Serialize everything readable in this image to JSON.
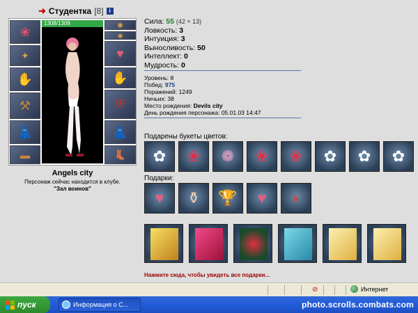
{
  "character": {
    "name": "Студентка",
    "level": "[8]",
    "hp": "1308/1308",
    "hp_fraction": 1.0,
    "city": "Angels city",
    "location_line1": "Персонаж сейчас находится в клубе.",
    "location_line2": "\"Зал воинов\""
  },
  "stats": {
    "strength_label": "Сила:",
    "strength_value": "55",
    "strength_bonus": "(42 + 13)",
    "agility_label": "Ловкость:",
    "agility_value": "3",
    "intuition_label": "Интуиция:",
    "intuition_value": "3",
    "endurance_label": "Выносливость:",
    "endurance_value": "50",
    "intellect_label": "Интеллект:",
    "intellect_value": "0",
    "wisdom_label": "Мудрость:",
    "wisdom_value": "0"
  },
  "details": {
    "level_label": "Уровень:",
    "level_value": "8",
    "wins_label": "Побед:",
    "wins_value": "975",
    "losses_label": "Поражений:",
    "losses_value": "1249",
    "draws_label": "Ничьих:",
    "draws_value": "38",
    "birthplace_label": "Место рождения:",
    "birthplace_value": "Devils city",
    "birthday_label": "День рождения персонажа:",
    "birthday_value": "05.01.03 14:47"
  },
  "gifts": {
    "bouquets_label": "Подарены букеты цветов:",
    "bouquets": [
      "white-daisy-bouquet-icon",
      "red-rose-bouquet-icon",
      "pink-flower-bouquet-icon",
      "red-rose-bouquet-icon",
      "red-rose-bouquet-icon",
      "white-daisy-bouquet-icon",
      "white-daisy-bouquet-icon",
      "white-daisy-bouquet-icon"
    ],
    "presents_label": "Подарки:",
    "presents": [
      "heart-card-icon",
      "perfume-bottle-icon",
      "golden-rose-icon",
      "heart-card-icon",
      "fan-icon"
    ],
    "cards": [
      "sparkle-card-icon",
      "pink-card-icon",
      "flower-card-icon",
      "teal-card-icon",
      "gold-card-icon",
      "gold-card-icon"
    ],
    "more_link": "Нажмите сюда, чтобы увидеть все подарки..."
  },
  "statusbar": {
    "zone": "Интернет"
  },
  "taskbar": {
    "start_label": "пуск",
    "window_title": "Информация о С...",
    "watermark": "photo.scrolls.combats.com"
  },
  "colors": {
    "page_bg": "#dedede",
    "taskbar_blue": "#245edb",
    "start_green": "#3fa83f",
    "link_red": "#990000",
    "stat_green": "#1f7a1f",
    "hp_green": "#33a847"
  }
}
